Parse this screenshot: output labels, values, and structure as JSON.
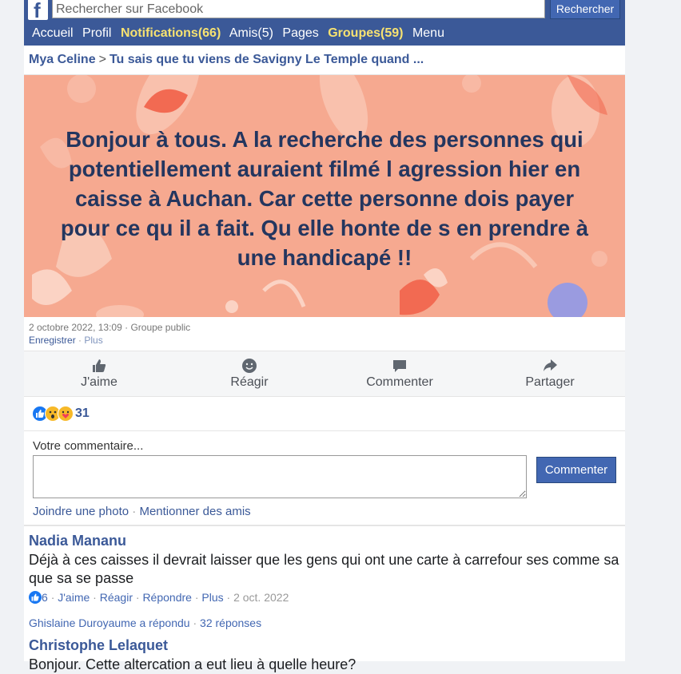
{
  "header": {
    "logo": "f",
    "search_placeholder": "Rechercher sur Facebook",
    "search_button": "Rechercher",
    "nav": {
      "home": "Accueil",
      "profile": "Profil",
      "notifications": "Notifications(66)",
      "friends": "Amis(5)",
      "pages": "Pages",
      "groups": "Groupes(59)",
      "menu": "Menu"
    }
  },
  "breadcrumb": {
    "author": "Mya Celine",
    "separator": ">",
    "group": "Tu sais que tu viens de Savigny Le Temple quand ..."
  },
  "post": {
    "text": "Bonjour à tous. A la recherche des personnes qui potentiellement auraient filmé l agression hier en caisse à Auchan. Car cette personne dois payer pour ce qu il a fait. Qu elle honte de s en prendre à une handicapé !!",
    "date": "2 octobre 2022, 13:09",
    "audience": "Groupe public",
    "save": "Enregistrer",
    "more": "Plus",
    "background_color": "#f6a990",
    "text_color": "#24365f"
  },
  "actions": {
    "like": "J'aime",
    "react": "Réagir",
    "comment": "Commenter",
    "share": "Partager"
  },
  "reactions": {
    "icons": [
      "like-icon",
      "wow-icon",
      "care-icon"
    ],
    "count": "31"
  },
  "composer": {
    "label": "Votre commentaire...",
    "submit": "Commenter",
    "attach_photo": "Joindre une photo",
    "mention": "Mentionner des amis"
  },
  "comments": [
    {
      "author": "Nadia Mananu",
      "text": "Déjà à ces caisses il devrait laisser que les gens qui ont une carte à carrefour ses comme sa que sa se passe",
      "like_count": "6",
      "like": "J'aime",
      "react": "Réagir",
      "reply": "Répondre",
      "more": "Plus",
      "date": "2 oct. 2022",
      "reply_author": "Ghislaine Duroyaume a répondu",
      "reply_count": "32 réponses"
    },
    {
      "author": "Christophe Lelaquet",
      "text": "Bonjour. Cette altercation a eut lieu à quelle heure?"
    }
  ],
  "colors": {
    "brand": "#3b5998",
    "button": "#4267b2",
    "nav_highlight": "#f7e271"
  }
}
